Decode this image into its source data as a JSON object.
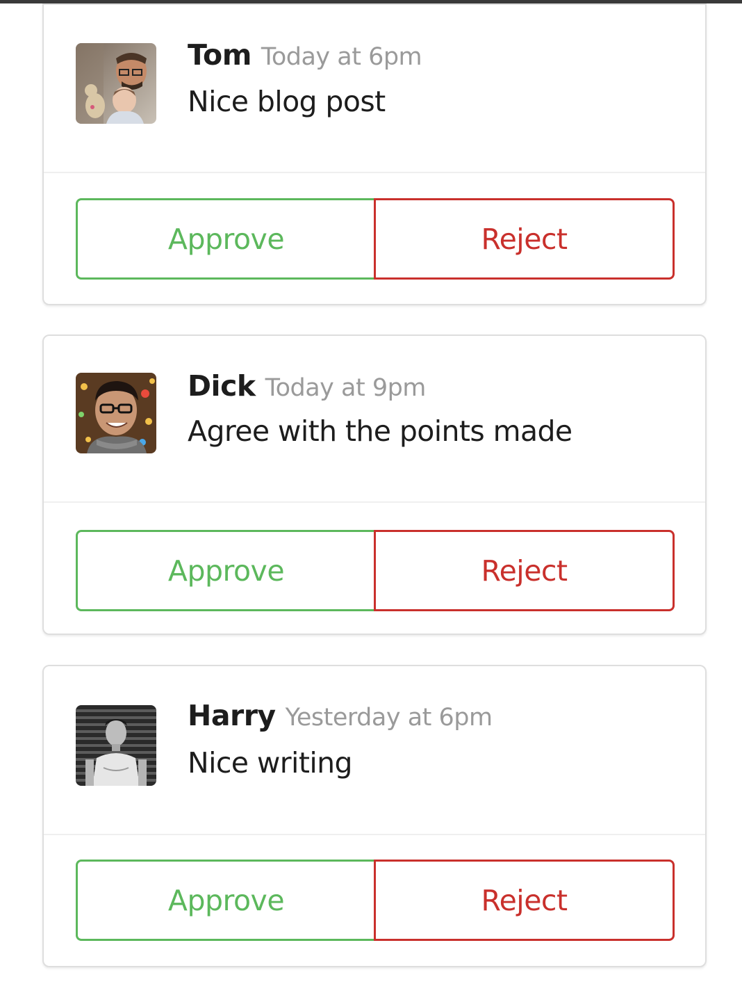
{
  "comments": [
    {
      "name": "Tom",
      "time": "Today at 6pm",
      "message": "Nice blog post",
      "approve_label": "Approve",
      "reject_label": "Reject"
    },
    {
      "name": "Dick",
      "time": "Today at 9pm",
      "message": "Agree with the points made",
      "approve_label": "Approve",
      "reject_label": "Reject"
    },
    {
      "name": "Harry",
      "time": "Yesterday at 6pm",
      "message": "Nice writing",
      "approve_label": "Approve",
      "reject_label": "Reject"
    }
  ],
  "colors": {
    "approve": "#5cb85c",
    "reject": "#c9302c",
    "name_text": "#1d1d1d",
    "time_text": "#9a9a9a",
    "card_border": "#dedede"
  }
}
